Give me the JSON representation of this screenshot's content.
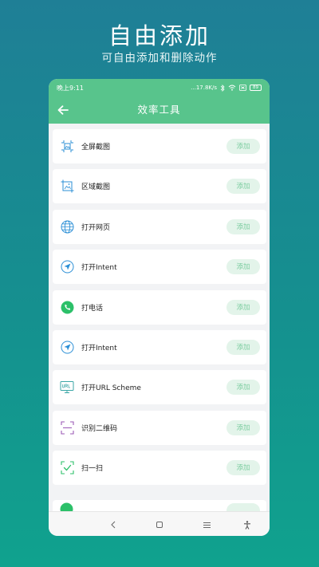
{
  "promo": {
    "title": "自由添加",
    "subtitle": "可自由添加和删除动作"
  },
  "status_bar": {
    "time": "晚上9:11",
    "speed": "...17.8K/s",
    "battery": "89"
  },
  "toolbar": {
    "title": "效率工具"
  },
  "colors": {
    "brand_green": "#58c48c",
    "add_button_bg": "#e3f4ea",
    "add_button_text": "#7ccda0",
    "icon_blue": "#2b8fd6",
    "icon_teal": "#3aa6a6",
    "icon_purple": "#9b59b6",
    "icon_green": "#2cc069"
  },
  "items": [
    {
      "label": "全屏截图",
      "icon": "fullscreen-screenshot-icon",
      "action": "添加"
    },
    {
      "label": "区域截图",
      "icon": "area-screenshot-icon",
      "action": "添加"
    },
    {
      "label": "打开网页",
      "icon": "globe-icon",
      "action": "添加"
    },
    {
      "label": "打开Intent",
      "icon": "send-arrow-icon",
      "action": "添加"
    },
    {
      "label": "打电话",
      "icon": "phone-icon",
      "action": "添加"
    },
    {
      "label": "打开Intent",
      "icon": "send-arrow-icon",
      "action": "添加"
    },
    {
      "label": "打开URL Scheme",
      "icon": "url-monitor-icon",
      "action": "添加"
    },
    {
      "label": "识别二维码",
      "icon": "qr-scan-icon",
      "action": "添加"
    },
    {
      "label": "扫一扫",
      "icon": "scan-check-icon",
      "action": "添加"
    }
  ],
  "nav_bar": {
    "buttons": [
      "back-nav-icon",
      "home-nav-icon",
      "menu-nav-icon",
      "accessibility-icon"
    ]
  }
}
